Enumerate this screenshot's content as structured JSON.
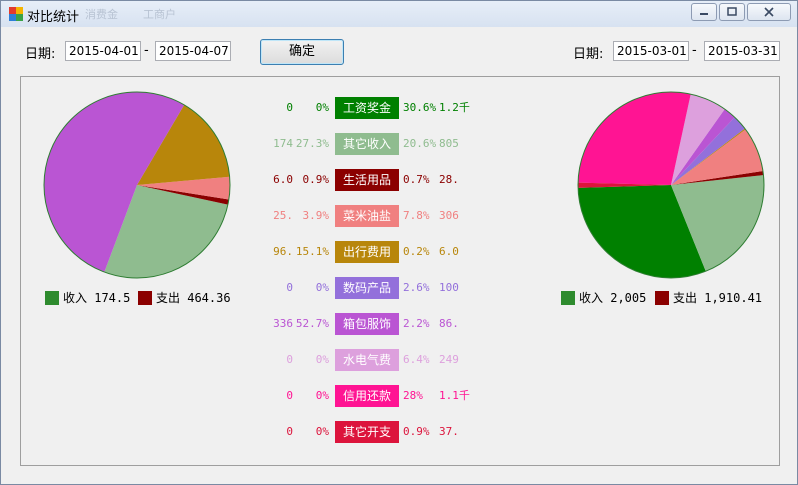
{
  "window": {
    "title": "对比统计",
    "ghost_tabs": [
      "消费金",
      "工商户"
    ]
  },
  "controls": {
    "label_left": "日期:",
    "date_left_start": "2015-04-01",
    "date_left_end": "2015-04-07",
    "sep_left": "-",
    "ok_button": "确定",
    "label_right": "日期:",
    "date_right_start": "2015-03-01",
    "date_right_end": "2015-03-31",
    "sep_right": "-"
  },
  "legend_left": {
    "income": "收入 174.5",
    "expense": "支出 464.36"
  },
  "legend_right": {
    "income": "收入 2,005",
    "expense": "支出 1,910.41"
  },
  "colors": {
    "income": "#2e8b2e",
    "expense": "#8b0000"
  },
  "categories": [
    {
      "name": "工资奖金",
      "color": "#008000",
      "left_val": "0",
      "left_pct": "0%",
      "right_pct": "30.6%",
      "right_val": "1.2千"
    },
    {
      "name": "其它收入",
      "color": "#8fbc8f",
      "left_val": "174",
      "left_pct": "27.3%",
      "right_pct": "20.6%",
      "right_val": "805"
    },
    {
      "name": "生活用品",
      "color": "#8b0000",
      "left_val": "6.0",
      "left_pct": "0.9%",
      "right_pct": "0.7%",
      "right_val": "28."
    },
    {
      "name": "菜米油盐",
      "color": "#f08080",
      "left_val": "25.",
      "left_pct": "3.9%",
      "right_pct": "7.8%",
      "right_val": "306"
    },
    {
      "name": "出行费用",
      "color": "#b8860b",
      "left_val": "96.",
      "left_pct": "15.1%",
      "right_pct": "0.2%",
      "right_val": "6.0"
    },
    {
      "name": "数码产品",
      "color": "#9370db",
      "left_val": "0",
      "left_pct": "0%",
      "right_pct": "2.6%",
      "right_val": "100"
    },
    {
      "name": "箱包服饰",
      "color": "#ba55d3",
      "left_val": "336",
      "left_pct": "52.7%",
      "right_pct": "2.2%",
      "right_val": "86."
    },
    {
      "name": "水电气费",
      "color": "#dda0dd",
      "left_val": "0",
      "left_pct": "0%",
      "right_pct": "6.4%",
      "right_val": "249"
    },
    {
      "name": "信用还款",
      "color": "#ff1493",
      "left_val": "0",
      "left_pct": "0%",
      "right_pct": "28%",
      "right_val": "1.1千"
    },
    {
      "name": "其它开支",
      "color": "#dc143c",
      "left_val": "0",
      "left_pct": "0%",
      "right_pct": "0.9%",
      "right_val": "37."
    }
  ],
  "chart_data": [
    {
      "type": "pie",
      "labels": [
        "工资奖金",
        "其它收入",
        "生活用品",
        "菜米油盐",
        "出行费用",
        "数码产品",
        "箱包服饰",
        "水电气费",
        "信用还款",
        "其它开支"
      ],
      "values": [
        0,
        27.3,
        0.9,
        3.9,
        15.1,
        0,
        52.7,
        0,
        0,
        0
      ]
    },
    {
      "type": "pie",
      "labels": [
        "工资奖金",
        "其它收入",
        "生活用品",
        "菜米油盐",
        "出行费用",
        "数码产品",
        "箱包服饰",
        "水电气费",
        "信用还款",
        "其它开支"
      ],
      "values": [
        30.6,
        20.6,
        0.7,
        7.8,
        0.2,
        2.6,
        2.2,
        6.4,
        28,
        0.9
      ]
    }
  ]
}
